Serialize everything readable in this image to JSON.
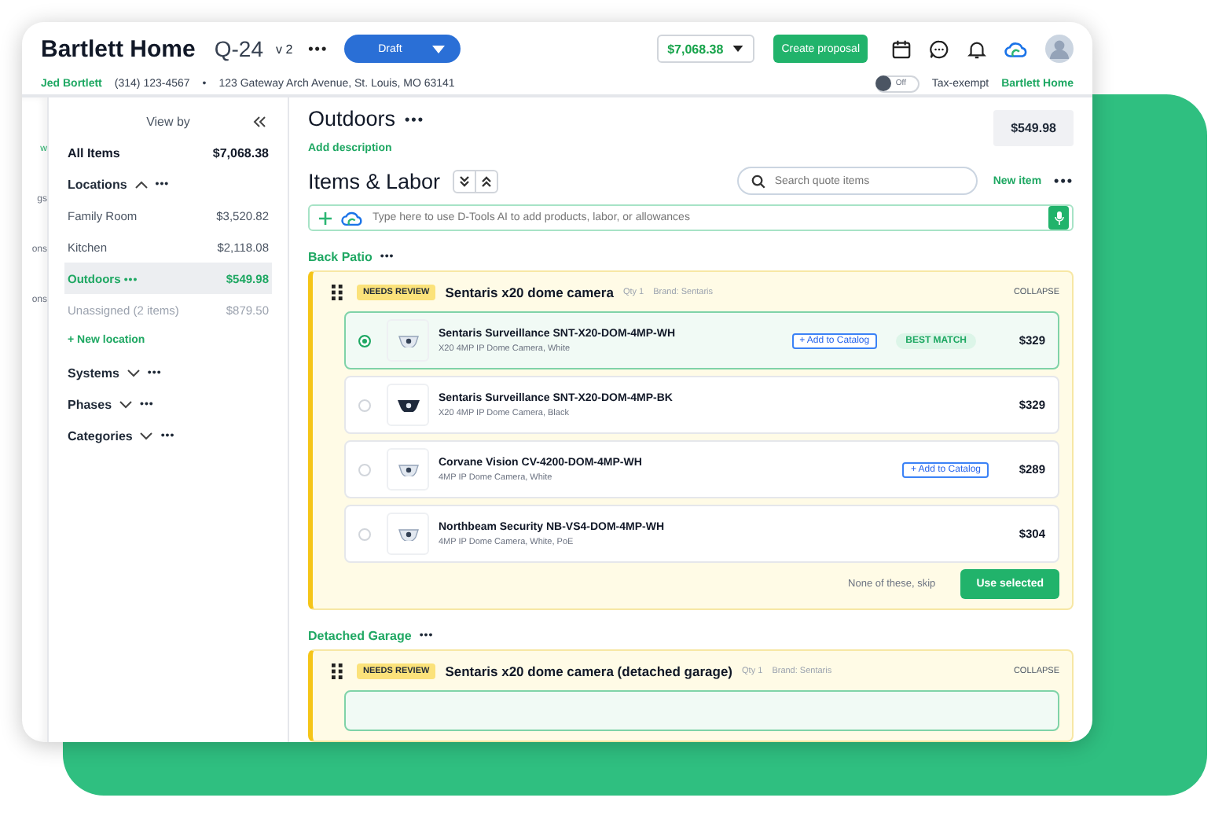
{
  "header": {
    "title": "Bartlett Home",
    "quote_number": "Q-24",
    "version": "v 2",
    "more": "•••",
    "status": "Draft",
    "total": "$7,068.38",
    "create_button": "Create proposal",
    "client_name": "Jed Bortlett",
    "phone": "(314) 123-4567",
    "bullet": "•",
    "address": "123 Gateway Arch Avenue, St. Louis, MO 63141",
    "tax_toggle": {
      "label": "Off",
      "on": false
    },
    "tax_label": "Tax-exempt",
    "account": "Bartlett Home"
  },
  "left_rail": [
    {
      "label": "w",
      "selected": true
    },
    {
      "label": "gs",
      "selected": false
    },
    {
      "label": "ons",
      "selected": false
    },
    {
      "label": "ons",
      "selected": false
    }
  ],
  "sidebar": {
    "heading": "View by",
    "all_items": {
      "label": "All Items",
      "amount": "$7,068.38"
    },
    "locations": {
      "label": "Locations",
      "expanded": true,
      "more": "•••",
      "items": [
        {
          "label": "Family Room",
          "amount": "$3,520.82",
          "selected": false,
          "muted": false
        },
        {
          "label": "Kitchen",
          "amount": "$2,118.08",
          "selected": false,
          "muted": false
        },
        {
          "label": "Outdoors",
          "more": "•••",
          "amount": "$549.98",
          "selected": true,
          "muted": false
        },
        {
          "label": "Unassigned (2 items)",
          "amount": "$879.50",
          "selected": false,
          "muted": true
        }
      ]
    },
    "new_location": "+ New location",
    "groups": [
      {
        "label": "Systems",
        "expanded": false,
        "more": "•••"
      },
      {
        "label": "Phases",
        "expanded": false,
        "more": "•••"
      },
      {
        "label": "Categories",
        "expanded": false,
        "more": "•••"
      }
    ]
  },
  "main": {
    "title": "Outdoors",
    "more": "•••",
    "add_description": "Add description",
    "total": "$549.98",
    "section_title": "Items & Labor",
    "search": {
      "placeholder": "Search quote items"
    },
    "new_item": "New item",
    "section_more": "•••",
    "ai_input": {
      "placeholder": "Type here to use D-Tools AI to add products, labor, or allowances"
    },
    "groups": [
      {
        "name": "Back Patio",
        "more": "•••",
        "items": [
          {
            "badge": "NEEDS REVIEW",
            "title": "Sentaris x20 dome camera",
            "qty": "Qty 1",
            "brand": "Brand: Sentaris",
            "collapse": "COLLAPSE",
            "options": [
              {
                "kind": "white-camera",
                "name": "Sentaris Surveillance SNT-X20-DOM-4MP-WH",
                "desc": "X20 4MP IP Dome Camera, White",
                "add_to_catalog": "+ Add to Catalog",
                "badge": "BEST MATCH",
                "price": "$329",
                "selected": true
              },
              {
                "kind": "black-camera",
                "name": "Sentaris Surveillance SNT-X20-DOM-4MP-BK",
                "desc": "X20 4MP IP Dome Camera, Black",
                "price": "$329",
                "selected": false
              },
              {
                "kind": "white-camera",
                "name": "Corvane Vision CV-4200-DOM-4MP-WH",
                "desc": "4MP IP Dome Camera, White",
                "add_to_catalog": "+ Add to Catalog",
                "price": "$289",
                "selected": false
              },
              {
                "kind": "white-camera",
                "name": "Northbeam Security NB-VS4-DOM-4MP-WH",
                "desc": "4MP IP Dome Camera, White, PoE",
                "price": "$304",
                "selected": false
              }
            ],
            "skip": "None of these, skip",
            "use": "Use selected"
          }
        ]
      },
      {
        "name": "Detached Garage",
        "more": "•••",
        "items": [
          {
            "badge": "NEEDS REVIEW",
            "title": "Sentaris x20 dome camera (detached garage)",
            "qty": "Qty 1",
            "brand": "Brand: Sentaris",
            "collapse": "COLLAPSE"
          }
        ]
      }
    ]
  }
}
